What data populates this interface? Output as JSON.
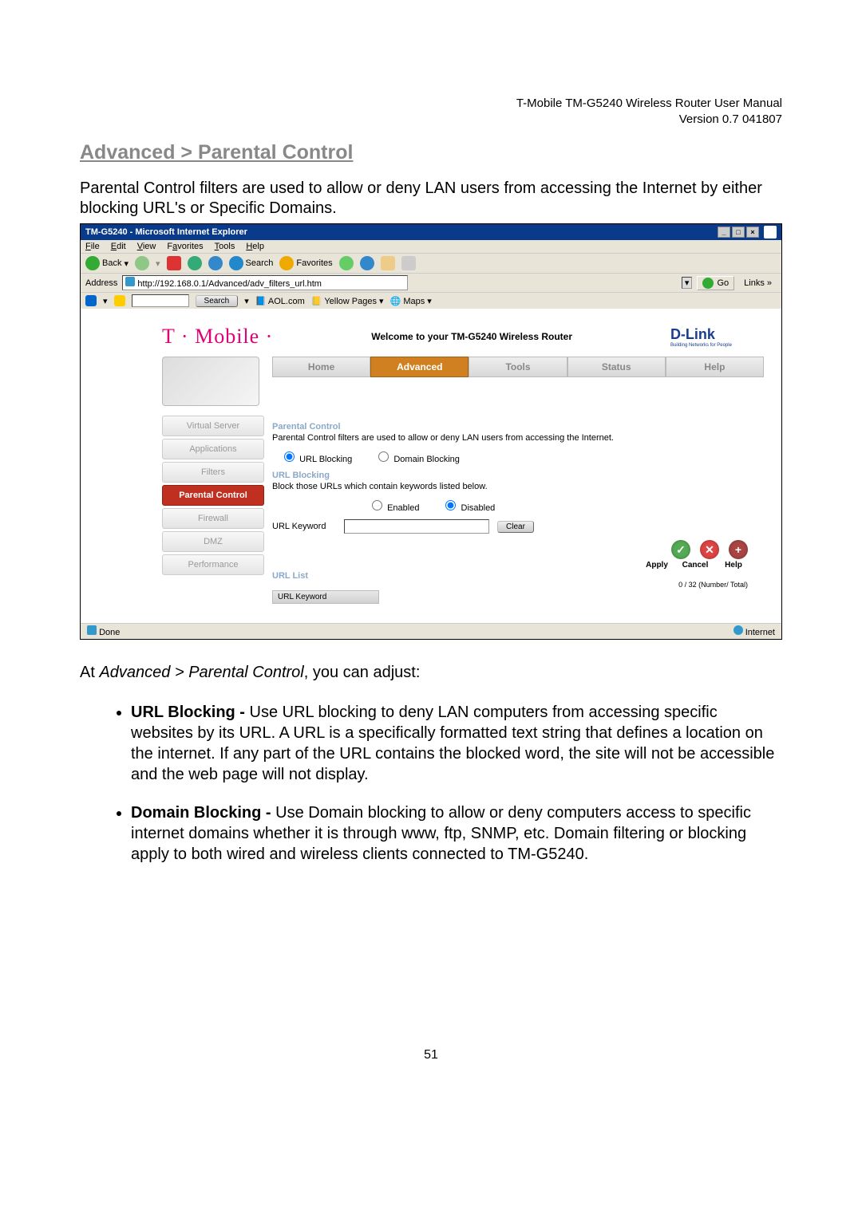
{
  "doc_header": {
    "line1": "T-Mobile TM-G5240 Wireless Router User Manual",
    "line2": "Version 0.7 041807"
  },
  "section_title": "Advanced > Parental Control",
  "intro": "Parental Control filters are used to allow or deny LAN users from accessing the Internet by either blocking URL's or Specific Domains.",
  "ie": {
    "title": "TM-G5240 - Microsoft Internet Explorer",
    "menu": {
      "file": "File",
      "edit": "Edit",
      "view": "View",
      "favorites": "Favorites",
      "tools": "Tools",
      "help": "Help"
    },
    "toolbar": {
      "back": "Back",
      "search": "Search",
      "favorites": "Favorites"
    },
    "address_label": "Address",
    "address_url": "http://192.168.0.1/Advanced/adv_filters_url.htm",
    "go": "Go",
    "links": "Links »",
    "second": {
      "search": "Search",
      "aol": "AOL.com",
      "yp": "Yellow Pages",
      "maps": "Maps"
    },
    "status_done": "Done",
    "status_zone": "Internet"
  },
  "router": {
    "brand": "T · Mobile ·",
    "welcome": "Welcome to your TM-G5240 Wireless Router",
    "dlink": "D-Link",
    "dlink_sub": "Building Networks for People",
    "tabs": {
      "home": "Home",
      "advanced": "Advanced",
      "tools": "Tools",
      "status": "Status",
      "help": "Help"
    },
    "side": {
      "vs": "Virtual Server",
      "apps": "Applications",
      "filters": "Filters",
      "pc": "Parental Control",
      "fw": "Firewall",
      "dmz": "DMZ",
      "perf": "Performance"
    },
    "pc_head": "Parental Control",
    "pc_desc": "Parental Control filters are used to allow or deny LAN users from accessing the Internet.",
    "r_url": "URL Blocking",
    "r_domain": "Domain Blocking",
    "ub_head": "URL Blocking",
    "ub_desc": "Block those URLs which contain keywords listed below.",
    "r_enabled": "Enabled",
    "r_disabled": "Disabled",
    "kw_label": "URL Keyword",
    "clear": "Clear",
    "apply": "Apply",
    "cancel": "Cancel",
    "help": "Help",
    "list_head": "URL List",
    "count": "0 / 32 (Number/ Total)",
    "list_col": "URL Keyword"
  },
  "outro_pre": "At ",
  "outro_em": "Advanced > Parental Control",
  "outro_post": ", you can adjust:",
  "bullets": {
    "b1_title": "URL Blocking - ",
    "b1_body": "Use URL blocking to deny LAN computers from accessing specific websites by its URL. A URL is a specifically formatted text string that defines a location on the internet. If any part of the URL contains the blocked word, the site will not be accessible and the web page will not display.",
    "b2_title": "Domain Blocking - ",
    "b2_body": "Use Domain blocking to allow or deny computers access to specific internet domains whether it is through www, ftp, SNMP, etc. Domain filtering or blocking apply to both wired and wireless clients connected to TM-G5240."
  },
  "page_num": "51"
}
